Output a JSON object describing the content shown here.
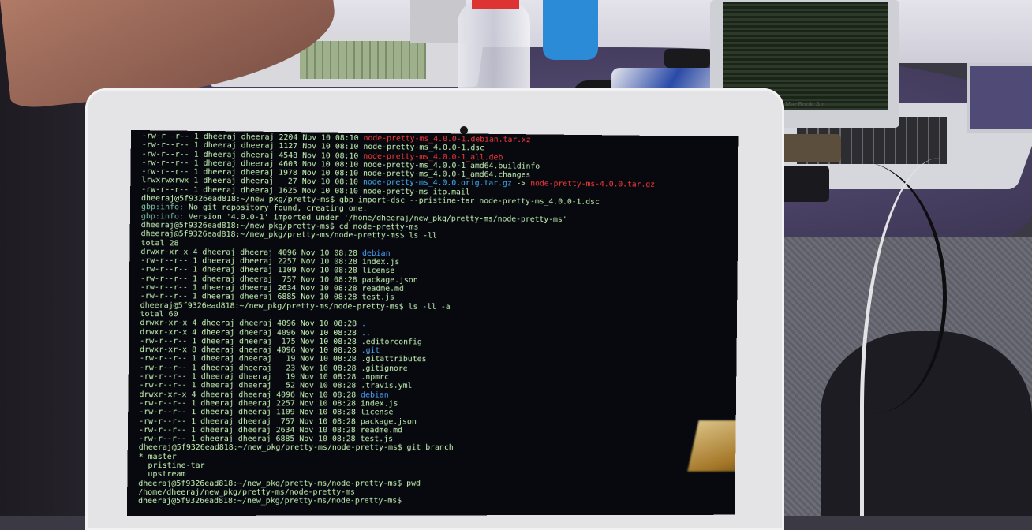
{
  "scene": {
    "background_laptop_brand": "MacBook Air"
  },
  "terminal": {
    "lines": [
      {
        "text": "-rw-r--r-- 1 dheeraj dheeraj 2204 Nov 10 08:10 ",
        "tail": "node-pretty-ms_4.0.0-1.debian.tar.xz",
        "tail_class": "red"
      },
      {
        "text": "-rw-r--r-- 1 dheeraj dheeraj 1127 Nov 10 08:10 ",
        "tail": "node-pretty-ms_4.0.0-1.dsc",
        "tail_class": ""
      },
      {
        "text": "-rw-r--r-- 1 dheeraj dheeraj 4548 Nov 10 08:10 ",
        "tail": "node-pretty-ms_4.0.0-1_all.deb",
        "tail_class": "red"
      },
      {
        "text": "-rw-r--r-- 1 dheeraj dheeraj 4603 Nov 10 08:10 ",
        "tail": "node-pretty-ms_4.0.0-1_amd64.buildinfo",
        "tail_class": ""
      },
      {
        "text": "-rw-r--r-- 1 dheeraj dheeraj 1978 Nov 10 08:10 ",
        "tail": "node-pretty-ms_4.0.0-1_amd64.changes",
        "tail_class": ""
      },
      {
        "text": "lrwxrwxrwx 1 dheeraj dheeraj   27 Nov 10 08:10 ",
        "tail": "node-pretty-ms_4.0.0.orig.tar.gz",
        "tail_class": "cyan",
        "extra": " -> ",
        "extra2": "node-pretty-ms-4.0.0.tar.gz",
        "extra2_class": "red"
      },
      {
        "text": "-rw-r--r-- 1 dheeraj dheeraj 1625 Nov 10 08:10 ",
        "tail": "node-pretty-ms_itp.mail",
        "tail_class": ""
      },
      {
        "text": "dheeraj@5f9326ead818:~/new_pkg/pretty-ms$ gbp import-dsc --pristine-tar node-pretty-ms_4.0.0-1.dsc",
        "tail": "",
        "tail_class": ""
      },
      {
        "text": "",
        "tail": "gbp:info:",
        "tail_class": "warn",
        "extra": " No git repository found, creating one."
      },
      {
        "text": "",
        "tail": "gbp:info:",
        "tail_class": "warn",
        "extra": " Version '4.0.0-1' imported under '/home/dheeraj/new_pkg/pretty-ms/node-pretty-ms'"
      },
      {
        "text": "dheeraj@5f9326ead818:~/new_pkg/pretty-ms$ cd node-pretty-ms",
        "tail": "",
        "tail_class": ""
      },
      {
        "text": "dheeraj@5f9326ead818:~/new_pkg/pretty-ms/node-pretty-ms$ ls -ll",
        "tail": "",
        "tail_class": ""
      },
      {
        "text": "total 28",
        "tail": "",
        "tail_class": ""
      },
      {
        "text": "drwxr-xr-x 4 dheeraj dheeraj 4096 Nov 10 08:28 ",
        "tail": "debian",
        "tail_class": "dir"
      },
      {
        "text": "-rw-r--r-- 1 dheeraj dheeraj 2257 Nov 10 08:28 index.js",
        "tail": "",
        "tail_class": ""
      },
      {
        "text": "-rw-r--r-- 1 dheeraj dheeraj 1109 Nov 10 08:28 license",
        "tail": "",
        "tail_class": ""
      },
      {
        "text": "-rw-r--r-- 1 dheeraj dheeraj  757 Nov 10 08:28 package.json",
        "tail": "",
        "tail_class": ""
      },
      {
        "text": "-rw-r--r-- 1 dheeraj dheeraj 2634 Nov 10 08:28 readme.md",
        "tail": "",
        "tail_class": ""
      },
      {
        "text": "-rw-r--r-- 1 dheeraj dheeraj 6885 Nov 10 08:28 test.js",
        "tail": "",
        "tail_class": ""
      },
      {
        "text": "dheeraj@5f9326ead818:~/new_pkg/pretty-ms/node-pretty-ms$ ls -ll -a",
        "tail": "",
        "tail_class": ""
      },
      {
        "text": "total 60",
        "tail": "",
        "tail_class": ""
      },
      {
        "text": "drwxr-xr-x 4 dheeraj dheeraj 4096 Nov 10 08:28 ",
        "tail": ".",
        "tail_class": "dir"
      },
      {
        "text": "drwxr-xr-x 4 dheeraj dheeraj 4096 Nov 10 08:28 ",
        "tail": "..",
        "tail_class": "dir"
      },
      {
        "text": "-rw-r--r-- 1 dheeraj dheeraj  175 Nov 10 08:28 .editorconfig",
        "tail": "",
        "tail_class": ""
      },
      {
        "text": "drwxr-xr-x 8 dheeraj dheeraj 4096 Nov 10 08:28 ",
        "tail": ".git",
        "tail_class": "dir"
      },
      {
        "text": "-rw-r--r-- 1 dheeraj dheeraj   19 Nov 10 08:28 .gitattributes",
        "tail": "",
        "tail_class": ""
      },
      {
        "text": "-rw-r--r-- 1 dheeraj dheeraj   23 Nov 10 08:28 .gitignore",
        "tail": "",
        "tail_class": ""
      },
      {
        "text": "-rw-r--r-- 1 dheeraj dheeraj   19 Nov 10 08:28 .npmrc",
        "tail": "",
        "tail_class": ""
      },
      {
        "text": "-rw-r--r-- 1 dheeraj dheeraj   52 Nov 10 08:28 .travis.yml",
        "tail": "",
        "tail_class": ""
      },
      {
        "text": "drwxr-xr-x 4 dheeraj dheeraj 4096 Nov 10 08:28 ",
        "tail": "debian",
        "tail_class": "dir"
      },
      {
        "text": "-rw-r--r-- 1 dheeraj dheeraj 2257 Nov 10 08:28 index.js",
        "tail": "",
        "tail_class": ""
      },
      {
        "text": "-rw-r--r-- 1 dheeraj dheeraj 1109 Nov 10 08:28 license",
        "tail": "",
        "tail_class": ""
      },
      {
        "text": "-rw-r--r-- 1 dheeraj dheeraj  757 Nov 10 08:28 package.json",
        "tail": "",
        "tail_class": ""
      },
      {
        "text": "-rw-r--r-- 1 dheeraj dheeraj 2634 Nov 10 08:28 readme.md",
        "tail": "",
        "tail_class": ""
      },
      {
        "text": "-rw-r--r-- 1 dheeraj dheeraj 6885 Nov 10 08:28 test.js",
        "tail": "",
        "tail_class": ""
      },
      {
        "text": "dheeraj@5f9326ead818:~/new_pkg/pretty-ms/node-pretty-ms$ git branch",
        "tail": "",
        "tail_class": ""
      },
      {
        "text": "* master",
        "tail": "",
        "tail_class": ""
      },
      {
        "text": "  pristine-tar",
        "tail": "",
        "tail_class": ""
      },
      {
        "text": "  upstream",
        "tail": "",
        "tail_class": ""
      },
      {
        "text": "dheeraj@5f9326ead818:~/new_pkg/pretty-ms/node-pretty-ms$ pwd",
        "tail": "",
        "tail_class": ""
      },
      {
        "text": "/home/dheeraj/new_pkg/pretty-ms/node-pretty-ms",
        "tail": "",
        "tail_class": ""
      },
      {
        "text": "dheeraj@5f9326ead818:~/new_pkg/pretty-ms/node-pretty-ms$",
        "tail": "",
        "tail_class": ""
      }
    ]
  }
}
